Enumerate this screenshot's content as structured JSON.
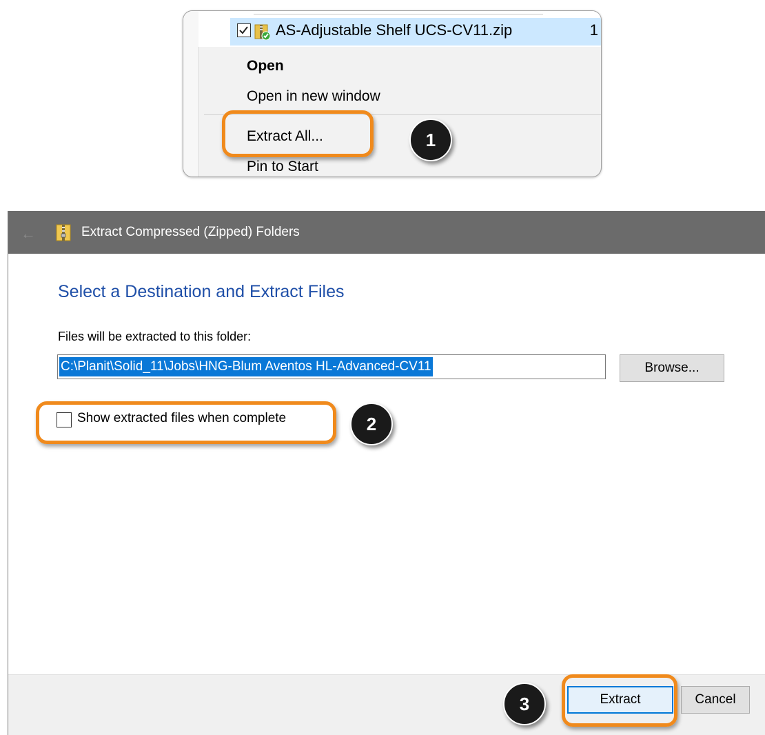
{
  "context_menu": {
    "file": {
      "name": "AS-Adjustable Shelf UCS-CV11.zip",
      "trailing_text": "1",
      "checked": true,
      "icon": "zip-folder-icon"
    },
    "items": [
      {
        "label": "Open",
        "bold": true
      },
      {
        "label": "Open in new window",
        "bold": false
      },
      {
        "label": "Extract All...",
        "bold": false
      },
      {
        "label": "Pin to Start",
        "bold": false
      }
    ]
  },
  "callouts": [
    "1",
    "2",
    "3"
  ],
  "dialog": {
    "title": "Extract Compressed (Zipped) Folders",
    "heading": "Select a Destination and Extract Files",
    "destination_label": "Files will be extracted to this folder:",
    "destination_path": "C:\\Planit\\Solid_11\\Jobs\\HNG-Blum Aventos HL-Advanced-CV11",
    "browse_label": "Browse...",
    "show_files_label": "Show extracted files when complete",
    "show_files_checked": false,
    "extract_label": "Extract",
    "cancel_label": "Cancel"
  },
  "colors": {
    "highlight": "#f08a1c",
    "heading": "#1f4fa8",
    "selection": "#0a78d7",
    "titlebar": "#6b6b6b",
    "default_button_border": "#0078d7"
  }
}
